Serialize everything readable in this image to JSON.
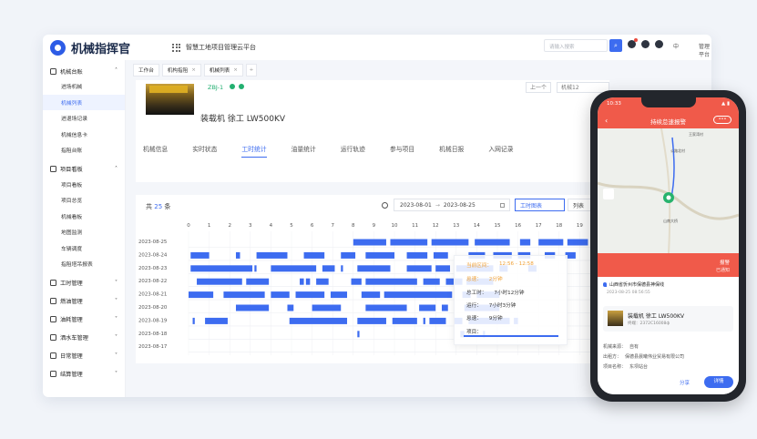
{
  "app": {
    "logo_text": "机械指挥官",
    "platform_title": "智慧工地项目管理云平台"
  },
  "topbar": {
    "search_placeholder": "请输入搜索",
    "language": "中",
    "manage_label": "管理平台"
  },
  "sidebar": {
    "groups": [
      {
        "label": "机械台账",
        "items": [
          "进场机械",
          "机械列表",
          "进退场记录",
          "机械信息卡",
          "指阻台账"
        ]
      },
      {
        "label": "项目看板",
        "items": [
          "项目看板",
          "项目总览",
          "机械看板",
          "地图监测",
          "车辆调度",
          "指阻塔吊报表"
        ]
      },
      {
        "label": "工时管理"
      },
      {
        "label": "燃油管理"
      },
      {
        "label": "油耗管理"
      },
      {
        "label": "洒水车管理"
      },
      {
        "label": "日常管理"
      },
      {
        "label": "结算管理"
      }
    ]
  },
  "page_tabs": [
    "工作台",
    "机构指阻",
    "机械列表"
  ],
  "device": {
    "code": "ZBJ-1",
    "name": "装载机  徐工  LW500KV",
    "prev_label": "上一个",
    "selector_value": "机械12"
  },
  "subtabs": [
    "机械信息",
    "实时状态",
    "工时统计",
    "油量统计",
    "运行轨迹",
    "参与项目",
    "机械日报",
    "入网记录"
  ],
  "chart_header": {
    "total_prefix": "共",
    "total_count": "25",
    "total_suffix": "条",
    "date_from": "2023-08-01",
    "date_sep": "→",
    "date_to": "2023-08-25",
    "view_gantt": "工时图表",
    "view_list": "列表"
  },
  "chart_data": {
    "type": "gantt",
    "x_ticks": [
      "0",
      "1",
      "2",
      "3",
      "4",
      "5",
      "6",
      "7",
      "8",
      "9",
      "10",
      "11",
      "12",
      "13",
      "14",
      "15",
      "16",
      "17",
      "18",
      "19"
    ],
    "xlim": [
      0,
      20
    ],
    "rows": [
      {
        "date": "2023-08-25",
        "segments": [
          [
            8.0,
            9.6
          ],
          [
            9.8,
            11.6
          ],
          [
            11.8,
            13.6
          ],
          [
            13.9,
            15.6
          ],
          [
            16.1,
            16.6
          ],
          [
            17.0,
            18.2
          ],
          [
            18.4,
            19.4
          ]
        ]
      },
      {
        "date": "2023-08-24",
        "segments": [
          [
            0.1,
            1.0
          ],
          [
            2.3,
            2.5
          ],
          [
            3.3,
            4.8
          ],
          [
            5.6,
            6.6
          ],
          [
            7.4,
            8.1
          ],
          [
            8.6,
            10.0
          ],
          [
            10.6,
            11.6
          ],
          [
            11.9,
            12.6
          ],
          [
            13.6,
            14.4
          ],
          [
            14.8,
            15.7
          ],
          [
            16.0,
            16.6
          ],
          [
            17.3,
            17.8
          ],
          [
            18.3,
            18.8
          ]
        ]
      },
      {
        "date": "2023-08-23",
        "segments": [
          [
            0.1,
            3.1
          ],
          [
            3.2,
            3.3
          ],
          [
            4.0,
            6.2
          ],
          [
            6.5,
            7.1
          ],
          [
            7.4,
            7.5
          ],
          [
            8.2,
            9.8
          ],
          [
            10.6,
            11.8
          ],
          [
            12.0,
            12.7
          ],
          [
            13.0,
            14.8
          ],
          [
            15.1,
            15.5
          ],
          [
            16.5,
            16.9
          ]
        ]
      },
      {
        "date": "2023-08-22",
        "segments": [
          [
            0.4,
            2.6
          ],
          [
            2.8,
            3.9
          ],
          [
            5.4,
            5.6
          ],
          [
            5.7,
            5.9
          ],
          [
            6.2,
            6.8
          ],
          [
            7.9,
            8.4
          ],
          [
            8.6,
            11.1
          ],
          [
            11.4,
            12.2
          ],
          [
            12.5,
            13.3
          ],
          [
            13.5,
            14.8
          ]
        ]
      },
      {
        "date": "2023-08-21",
        "segments": [
          [
            0.0,
            1.2
          ],
          [
            1.7,
            3.7
          ],
          [
            4.0,
            4.9
          ],
          [
            5.2,
            6.6
          ],
          [
            6.9,
            7.7
          ],
          [
            8.4,
            9.3
          ],
          [
            9.5,
            12.8
          ],
          [
            13.3,
            13.7
          ],
          [
            14.0,
            15.1
          ]
        ]
      },
      {
        "date": "2023-08-20",
        "segments": [
          [
            2.3,
            3.9
          ],
          [
            4.8,
            5.1
          ],
          [
            6.0,
            7.4
          ],
          [
            8.6,
            10.6
          ],
          [
            11.2,
            12.0
          ],
          [
            12.3,
            12.6
          ],
          [
            13.4,
            15.1
          ]
        ]
      },
      {
        "date": "2023-08-19",
        "segments": [
          [
            0.2,
            0.3
          ],
          [
            0.8,
            1.9
          ],
          [
            4.9,
            7.7
          ],
          [
            8.2,
            9.6
          ],
          [
            9.9,
            11.1
          ],
          [
            11.4,
            11.5
          ],
          [
            11.7,
            12.5
          ],
          [
            12.9,
            13.3
          ],
          [
            13.6,
            15.6
          ],
          [
            15.8,
            16.0
          ]
        ]
      },
      {
        "date": "2023-08-18",
        "segments": [
          [
            8.2,
            8.3
          ],
          [
            13.2,
            13.4
          ],
          [
            14.3,
            14.4
          ]
        ]
      },
      {
        "date": "2023-08-17",
        "segments": []
      },
      {
        "date": "2023-08-16",
        "segments": [
          [
            0.3,
            0.7
          ],
          [
            0.9,
            1.3
          ],
          [
            1.4,
            1.8
          ],
          [
            1.9,
            2.0
          ],
          [
            6.0,
            6.7
          ],
          [
            9.0,
            9.1
          ],
          [
            11.9,
            12.8
          ]
        ]
      }
    ]
  },
  "tooltip": {
    "rows": [
      {
        "k": "当前区间：",
        "v": "12:56 - 12:58",
        "highlight": true
      },
      {
        "k": "怠速：",
        "v": "2分钟",
        "highlight": true
      },
      {
        "k": "总工时：",
        "v": "7小时12分钟",
        "highlight": false
      },
      {
        "k": "运行：",
        "v": "7小时3分钟",
        "highlight": false
      },
      {
        "k": "怠速：",
        "v": "9分钟",
        "highlight": false
      },
      {
        "k": "项目：",
        "v": "",
        "highlight": false
      }
    ]
  },
  "phone": {
    "time": "10:33",
    "signal": "▲ ▮",
    "title": "持续怠速报警",
    "menu": "•••",
    "map_labels": [
      "王家湾村",
      "山南大桥",
      "公路北村"
    ],
    "alert_status": "报警",
    "alert_sub": "已通知",
    "address": "山西省忻州市保德县神保线",
    "address_time": "2023-08-25 08:56:55",
    "vehicle_name": "装载机  徐工  LW500KV",
    "vehicle_sub": "终端：2372C16008ф",
    "kv": [
      {
        "k": "机械来源：",
        "v": "自有"
      },
      {
        "k": "出租方：",
        "v": "保德县晨曦伟业贸易有限公司"
      },
      {
        "k": "项目名称：",
        "v": "东坝站台"
      }
    ],
    "share": "分享",
    "button": "详情"
  },
  "colors": {
    "accent": "#3d6cf0",
    "alert": "#f05a4a",
    "idle": "#f0a035",
    "active_bar": "#3d6cf0"
  }
}
